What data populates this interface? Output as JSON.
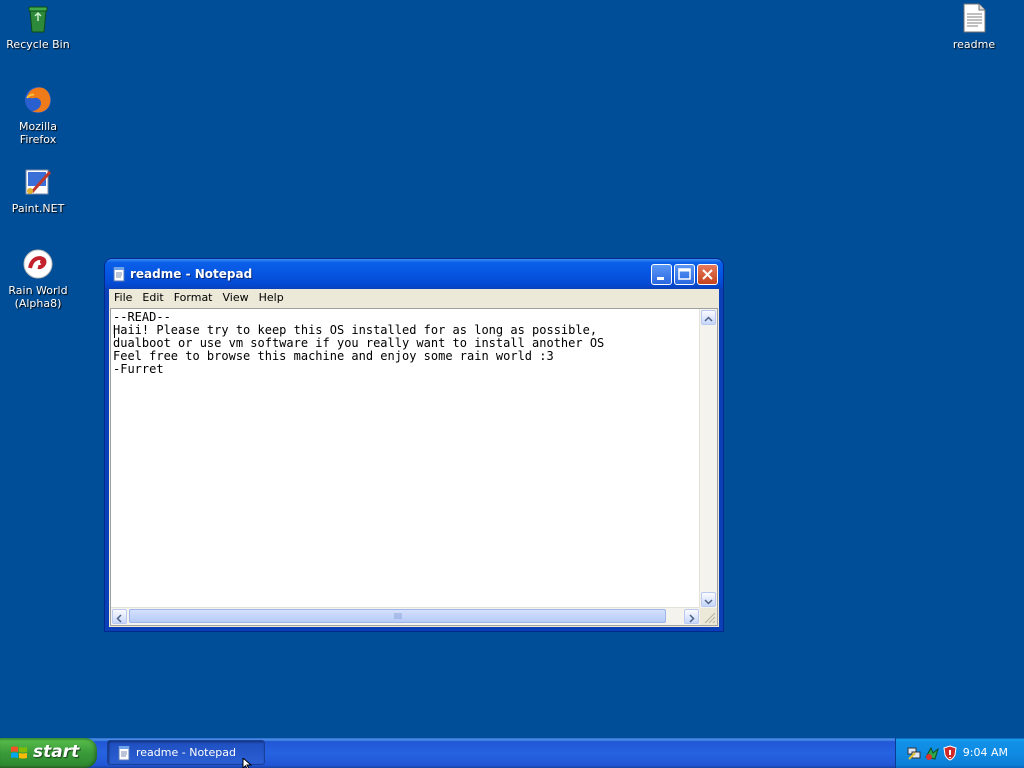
{
  "desktop": {
    "icons": [
      {
        "label": "Recycle Bin",
        "icon": "recycle-bin-icon"
      },
      {
        "label": "Mozilla Firefox",
        "icon": "firefox-icon"
      },
      {
        "label": "Paint.NET",
        "icon": "paint-net-icon"
      },
      {
        "label": "Rain World (Alpha8)",
        "icon": "rain-world-icon"
      },
      {
        "label": "readme",
        "icon": "text-file-icon"
      }
    ]
  },
  "notepad": {
    "title": "readme - Notepad",
    "menu": [
      "File",
      "Edit",
      "Format",
      "View",
      "Help"
    ],
    "content": "--READ--\nHaii! Please try to keep this OS installed for as long as possible,\ndualboot or use vm software if you really want to install another OS\nFeel free to browse this machine and enjoy some rain world :3\n-Furret"
  },
  "taskbar": {
    "start_label": "start",
    "tasks": [
      {
        "label": "readme - Notepad",
        "icon": "notepad-icon"
      }
    ],
    "tray_icons": [
      "network-icon",
      "security-icon",
      "shield-alert-icon"
    ],
    "clock": "9:04 AM"
  },
  "colors": {
    "desktop": "#004e98",
    "titlebar": "#0655e2",
    "taskbar": "#2663e0",
    "start": "#3a9a3a"
  }
}
